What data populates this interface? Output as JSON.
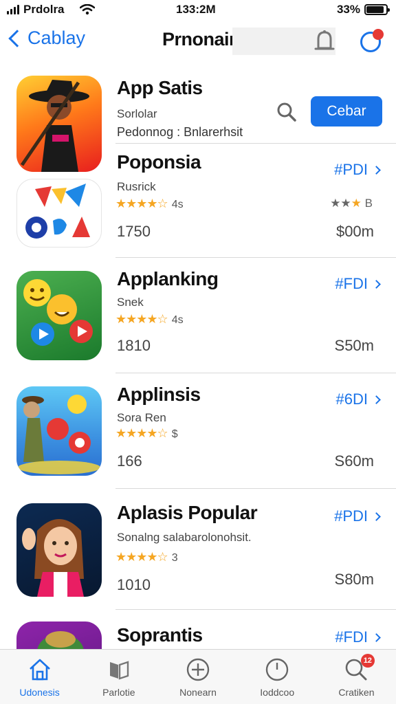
{
  "status_bar": {
    "carrier": "Prdolra",
    "time": "133:2M",
    "battery": "33%",
    "battery_level": 0.9
  },
  "nav": {
    "back_label": "Cablay",
    "title": "Prnonain"
  },
  "featured": {
    "name": "App Satis",
    "subtitle": "Sorlolar",
    "description": "Pedonnog : Bnlarerhsit",
    "button_label": "Cebar"
  },
  "apps": [
    {
      "name": "Poponsia",
      "subtitle": "Rusrick",
      "stars": "★★★★☆",
      "rating_count": "4s",
      "installs": "1750",
      "tag": "#PDI",
      "price": "$00m",
      "mini_rating_gray": "★★",
      "mini_rating_orange": "★",
      "mini_rating_text": "B"
    },
    {
      "name": "Applanking",
      "subtitle": "Snek",
      "stars": "★★★★☆",
      "rating_count": "4s",
      "installs": "1810",
      "tag": "#FDI",
      "price": "S50m"
    },
    {
      "name": "Applinsis",
      "subtitle": "Sora Ren",
      "stars": "★★★★☆",
      "rating_count": "$",
      "installs": "166",
      "tag": "#6DI",
      "price": "S60m"
    },
    {
      "name": "Aplasis Popular",
      "subtitle": "Sonalng  salabarolonohsit.",
      "stars": "★★★★☆",
      "rating_count": "3",
      "installs": "1010",
      "tag": "#PDI",
      "price": "S80m"
    },
    {
      "name": "Soprantis",
      "tag": "#FDI"
    }
  ],
  "tabs": [
    {
      "label": "Udonesis",
      "icon": "home-icon"
    },
    {
      "label": "Parlotie",
      "icon": "book-icon"
    },
    {
      "label": "Nonearn",
      "icon": "plus-circle-icon"
    },
    {
      "label": "Ioddcoo",
      "icon": "clock-icon"
    },
    {
      "label": "Cratiken",
      "icon": "search-icon",
      "badge": "12"
    }
  ],
  "colors": {
    "accent": "#1a73e8",
    "star": "#f5a623",
    "badge": "#e53935"
  }
}
